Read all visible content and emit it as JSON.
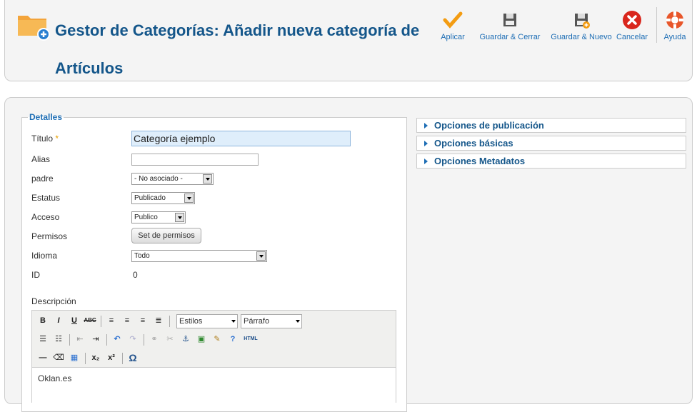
{
  "header": {
    "title": "Gestor de Categorías: Añadir nueva categoría de Artículos"
  },
  "toolbar": {
    "apply": "Aplicar",
    "save_close": "Guardar & Cerrar",
    "save_new": "Guardar & Nuevo",
    "cancel": "Cancelar",
    "help": "Ayuda"
  },
  "details": {
    "legend": "Detalles",
    "title_label": "Título",
    "required_mark": "*",
    "title_value": "Categoría ejemplo",
    "alias_label": "Alias",
    "alias_value": "",
    "parent_label": "padre",
    "parent_value": "- No asociado -",
    "status_label": "Estatus",
    "status_value": "Publicado",
    "access_label": "Acceso",
    "access_value": "Publico",
    "permissions_label": "Permisos",
    "permissions_button": "Set de permisos",
    "language_label": "Idioma",
    "language_value": "Todo",
    "id_label": "ID",
    "id_value": "0",
    "description_label": "Descripción"
  },
  "editor": {
    "styles": "Estilos",
    "format": "Párrafo",
    "content": "Oklan.es",
    "html_label": "HTML"
  },
  "sidebar": {
    "panels": [
      "Opciones de publicación",
      "Opciones básicas",
      "Opciones Metadatos"
    ]
  },
  "colors": {
    "title_blue": "#14568a",
    "link_blue": "#1e6eb5",
    "apply_orange": "#f39c12",
    "cancel_red": "#d9261c",
    "input_highlight": "#dfeefb"
  }
}
